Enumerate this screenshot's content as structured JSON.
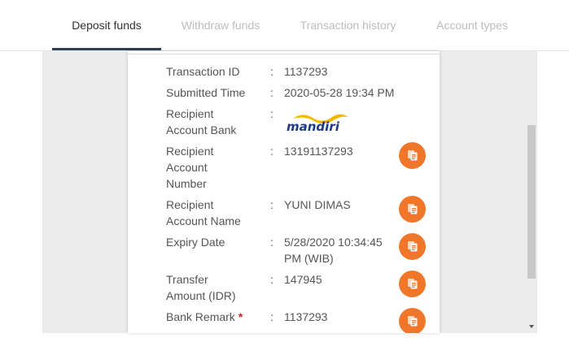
{
  "tabs": [
    {
      "label": "Deposit funds",
      "active": true
    },
    {
      "label": "Withdraw funds",
      "active": false
    },
    {
      "label": "Transaction history",
      "active": false
    },
    {
      "label": "Account types",
      "active": false
    }
  ],
  "details": {
    "separator": ":",
    "transaction_id": {
      "label": "Transaction ID",
      "value": "1137293"
    },
    "submitted_time": {
      "label": "Submitted Time",
      "value": "2020-05-28 19:34 PM"
    },
    "recipient_bank": {
      "label_line1": "Recipient",
      "label_line2": "Account Bank",
      "logo_text": "mandiri"
    },
    "account_number": {
      "label_line1": "Recipient",
      "label_line2": "Account",
      "label_line3": "Number",
      "value": "13191137293"
    },
    "account_name": {
      "label_line1": "Recipient",
      "label_line2": "Account Name",
      "value": "YUNI DIMAS"
    },
    "expiry_date": {
      "label": "Expiry Date",
      "value_line1": "5/28/2020 10:34:45",
      "value_line2": "PM (WIB)"
    },
    "transfer_amount": {
      "label_line1": "Transfer",
      "label_line2": "Amount (IDR)",
      "value": "147945"
    },
    "bank_remark": {
      "label": "Bank Remark",
      "required_mark": "*",
      "value": "1137293"
    }
  },
  "colors": {
    "accent_button": "#f0762a",
    "active_tab_underline": "#2b3f56",
    "mandiri_blue": "#1b3b8a",
    "mandiri_gold": "#f5b800"
  },
  "icons": {
    "copy": "copy-icon",
    "scroll_down": "scroll-down-arrow-icon"
  }
}
